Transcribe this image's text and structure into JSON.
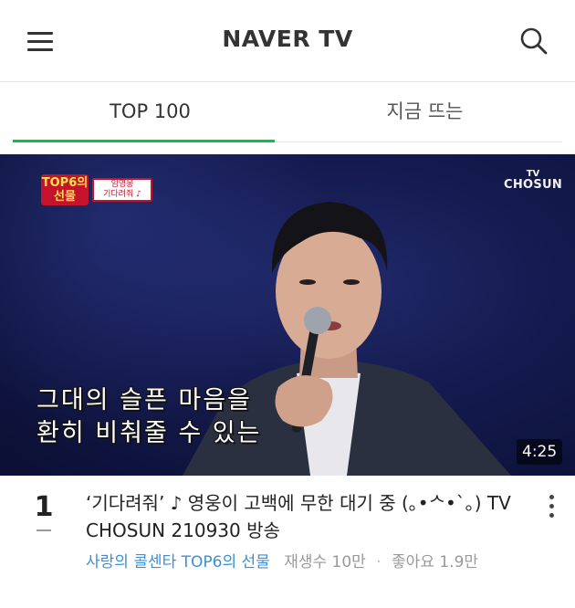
{
  "header": {
    "logo": "NAVER TV",
    "menu_icon": "hamburger-menu-icon",
    "search_icon": "search-icon"
  },
  "tabs": [
    {
      "label": "TOP 100",
      "active": true
    },
    {
      "label": "지금 뜨는",
      "active": false
    }
  ],
  "video": {
    "badge_main": "TOP6의\n선물",
    "badge_sub_name": "임영웅",
    "badge_sub_song": "기다려줘 ♪",
    "channel_logo_line1": "TV",
    "channel_logo_line2": "CHOSUN",
    "subtitle_line1": "그대의 슬픈 마음을",
    "subtitle_line2": "환히 비춰줄 수 있는",
    "duration": "4:25"
  },
  "item": {
    "rank": "1",
    "title": "‘기다려줘’ ♪ 영웅이 고백에 무한 대기 중 (｡•ᄉ•`｡) TV CHOSUN 210930 방송",
    "channel": "사랑의 콜센타 TOP6의 선물",
    "views": "재생수 10만",
    "likes": "좋아요 1.9만",
    "more_icon": "more-vertical-icon"
  },
  "colors": {
    "accent_green": "#00c73c",
    "channel_link": "#3c8fd6",
    "badge_red": "#c4132b"
  }
}
